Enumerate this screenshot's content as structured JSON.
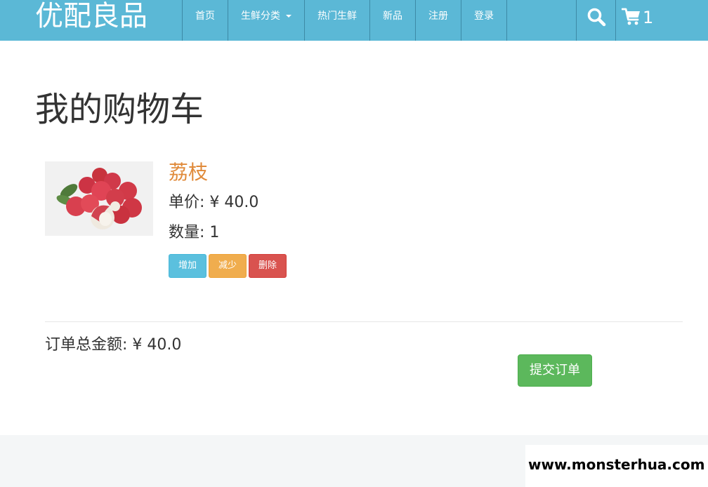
{
  "header": {
    "brand": "优配良品",
    "nav": [
      {
        "label": "首页"
      },
      {
        "label": "生鲜分类"
      },
      {
        "label": "热门生鲜"
      },
      {
        "label": "新品"
      },
      {
        "label": "注册"
      },
      {
        "label": "登录"
      }
    ],
    "cart_count": "1",
    "icons": {
      "search": "search-icon",
      "cart": "cart-icon",
      "dropdown": "caret-down-icon"
    }
  },
  "main": {
    "title": "我的购物车",
    "item": {
      "name": "荔枝",
      "price": "单价: ¥ 40.0",
      "quantity": "数量: 1",
      "buttons": {
        "increase": "增加",
        "decrease": "减少",
        "delete": "删除"
      }
    },
    "total": "订单总金额: ¥ 40.0",
    "submit_label": "提交订单"
  },
  "watermark": "www.monsterhua.com",
  "colors": {
    "navbar": "#5bb8d6",
    "item_name": "#e08a3a",
    "btn_increase": "#5bc0de",
    "btn_decrease": "#f0ad4e",
    "btn_delete": "#d9534f",
    "btn_submit": "#5cb85c",
    "footer": "#f4f6f7"
  }
}
